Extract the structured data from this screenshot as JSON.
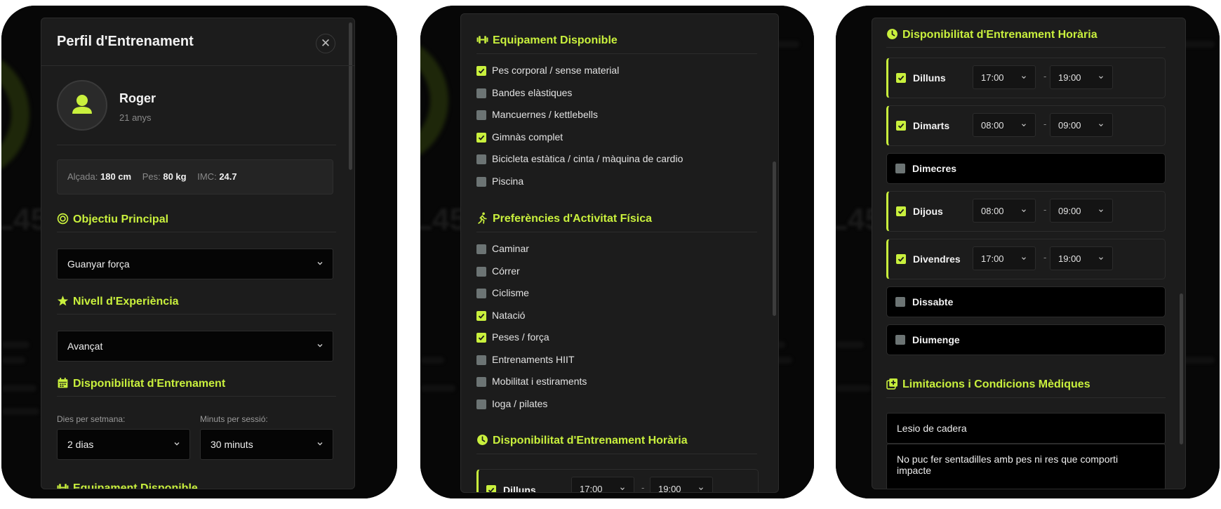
{
  "accent_color": "#c9f03d",
  "panel1": {
    "title": "Perfil d'Entrenament",
    "close_icon": "close-icon",
    "user": {
      "name": "Roger",
      "age": "21 anys",
      "icon": "user-icon"
    },
    "stats": [
      {
        "label": "Alçada:",
        "value": "180 cm"
      },
      {
        "label": "Pes:",
        "value": "80 kg"
      },
      {
        "label": "IMC:",
        "value": "24.7"
      }
    ],
    "objective": {
      "title": "Objectiu Principal",
      "icon": "target-icon",
      "value": "Guanyar força"
    },
    "experience": {
      "title": "Nivell d'Experiència",
      "icon": "star-icon",
      "value": "Avançat"
    },
    "availability": {
      "title": "Disponibilitat d'Entrenament",
      "icon": "calendar-icon",
      "days_label": "Dies per setmana:",
      "days_value": "2 dias",
      "minutes_label": "Minuts per sessió:",
      "minutes_value": "30 minuts"
    },
    "next_section": "Equipament Disponible"
  },
  "panel2": {
    "equipment": {
      "title": "Equipament Disponible",
      "icon": "dumbbell-icon",
      "items": [
        {
          "label": "Pes corporal / sense material",
          "checked": true
        },
        {
          "label": "Bandes elàstiques",
          "checked": false
        },
        {
          "label": "Mancuernes / kettlebells",
          "checked": false
        },
        {
          "label": "Gimnàs complet",
          "checked": true
        },
        {
          "label": "Bicicleta estàtica / cinta / màquina de cardio",
          "checked": false
        },
        {
          "label": "Piscina",
          "checked": false
        }
      ]
    },
    "activities": {
      "title": "Preferències d'Activitat Física",
      "icon": "running-icon",
      "items": [
        {
          "label": "Caminar",
          "checked": false
        },
        {
          "label": "Córrer",
          "checked": false
        },
        {
          "label": "Ciclisme",
          "checked": false
        },
        {
          "label": "Natació",
          "checked": true
        },
        {
          "label": "Peses / força",
          "checked": true
        },
        {
          "label": "Entrenaments HIIT",
          "checked": false
        },
        {
          "label": "Mobilitat i estiraments",
          "checked": false
        },
        {
          "label": "Ioga / pilates",
          "checked": false
        }
      ]
    },
    "schedule": {
      "title": "Disponibilitat d'Entrenament Horària",
      "icon": "clock-icon",
      "first_day": {
        "name": "Dilluns",
        "start": "17:00",
        "end": "19:00"
      }
    }
  },
  "panel3": {
    "schedule": {
      "title": "Disponibilitat d'Entrenament Horària",
      "icon": "clock-icon",
      "separator": "-",
      "days": [
        {
          "name": "Dilluns",
          "checked": true,
          "start": "17:00",
          "end": "19:00"
        },
        {
          "name": "Dimarts",
          "checked": true,
          "start": "08:00",
          "end": "09:00"
        },
        {
          "name": "Dimecres",
          "checked": false
        },
        {
          "name": "Dijous",
          "checked": true,
          "start": "08:00",
          "end": "09:00"
        },
        {
          "name": "Divendres",
          "checked": true,
          "start": "17:00",
          "end": "19:00"
        },
        {
          "name": "Dissabte",
          "checked": false
        },
        {
          "name": "Diumenge",
          "checked": false
        }
      ]
    },
    "medical": {
      "title": "Limitacions i Condicions Mèdiques",
      "icon": "medical-icon",
      "condition": "Lesio de cadera",
      "notes": "No puc fer sentadilles amb pes ni res que comporti impacte"
    }
  }
}
